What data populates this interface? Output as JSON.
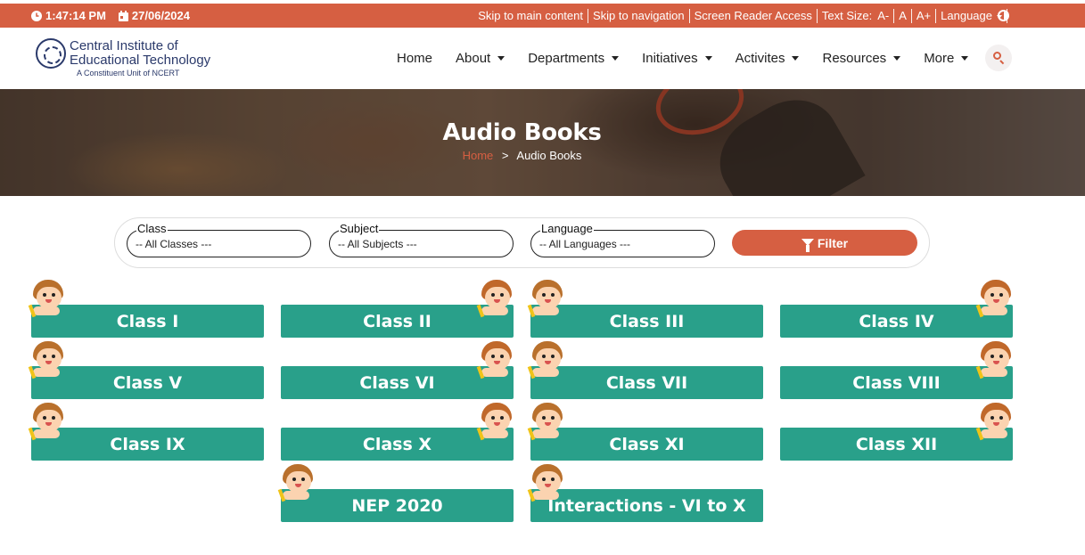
{
  "topbar": {
    "time": "1:47:14 PM",
    "date": "27/06/2024",
    "links": [
      "Skip to main content",
      "Skip to navigation",
      "Screen Reader Access"
    ],
    "text_size_label": "Text Size:",
    "text_size_options": [
      "A-",
      "A",
      "A+"
    ],
    "language_label": "Language",
    "bg_color": "#d65f42"
  },
  "logo": {
    "line1": "Central Institute of",
    "line2": "Educational Technology",
    "line3": "A Constituent Unit of NCERT"
  },
  "nav": {
    "items": [
      {
        "label": "Home",
        "dropdown": false
      },
      {
        "label": "About",
        "dropdown": true
      },
      {
        "label": "Departments",
        "dropdown": true
      },
      {
        "label": "Initiatives",
        "dropdown": true
      },
      {
        "label": "Activites",
        "dropdown": true
      },
      {
        "label": "Resources",
        "dropdown": true
      },
      {
        "label": "More",
        "dropdown": true
      }
    ]
  },
  "banner": {
    "title": "Audio Books",
    "breadcrumb_home": "Home",
    "breadcrumb_sep": ">",
    "breadcrumb_current": "Audio Books"
  },
  "filter": {
    "class_label": "Class",
    "class_value": "-- All Classes ---",
    "subject_label": "Subject",
    "subject_value": "-- All Subjects ---",
    "language_label": "Language",
    "language_value": "-- All Languages ---",
    "button_label": "Filter"
  },
  "cards": [
    {
      "label": "Class I",
      "kid": "left"
    },
    {
      "label": "Class II",
      "kid": "right"
    },
    {
      "label": "Class III",
      "kid": "left"
    },
    {
      "label": "Class IV",
      "kid": "right"
    },
    {
      "label": "Class V",
      "kid": "left"
    },
    {
      "label": "Class VI",
      "kid": "right"
    },
    {
      "label": "Class VII",
      "kid": "left"
    },
    {
      "label": "Class VIII",
      "kid": "right"
    },
    {
      "label": "Class IX",
      "kid": "left"
    },
    {
      "label": "Class X",
      "kid": "right"
    },
    {
      "label": "Class XI",
      "kid": "left"
    },
    {
      "label": "Class XII",
      "kid": "right"
    },
    {
      "label": "NEP 2020",
      "kid": "left"
    },
    {
      "label": "Interactions - VI to X",
      "kid": "left"
    }
  ],
  "colors": {
    "accent": "#d65f42",
    "card": "#29a08a",
    "logo_text": "#2b3a6b"
  },
  "icons": [
    "clock-icon",
    "calendar-icon",
    "contrast-icon",
    "search-icon",
    "filter-icon",
    "kid-illustration"
  ]
}
